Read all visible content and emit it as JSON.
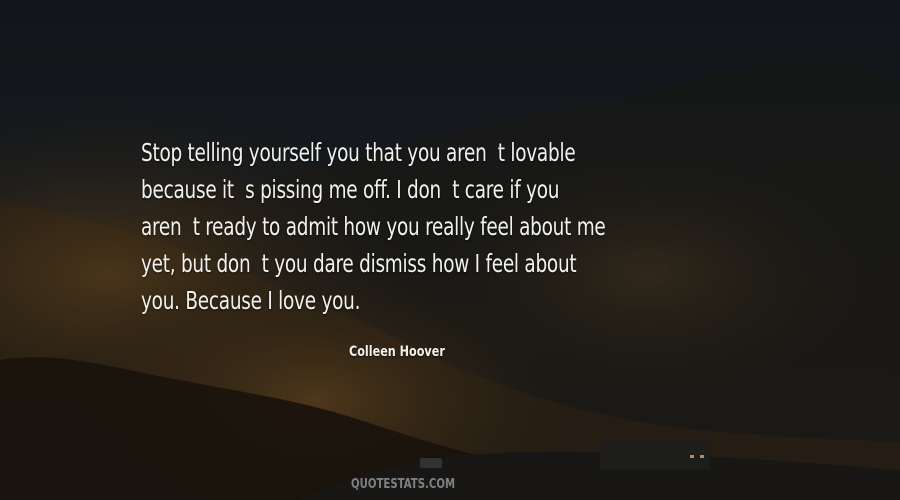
{
  "quote": {
    "lines": [
      "Stop telling yourself you that you aren  t lovable",
      "because it  s pissing me off. I don  t care if you",
      "aren  t ready to admit how you really feel about me",
      "yet, but don  t you dare dismiss how I feel about",
      "you. Because I love you."
    ]
  },
  "author": "Colleen Hoover",
  "watermark": "QUOTESTATS.COM",
  "colors": {
    "text": "#f1f1ee",
    "sky": "#1b1f22",
    "forest": "#3a2c1a"
  }
}
